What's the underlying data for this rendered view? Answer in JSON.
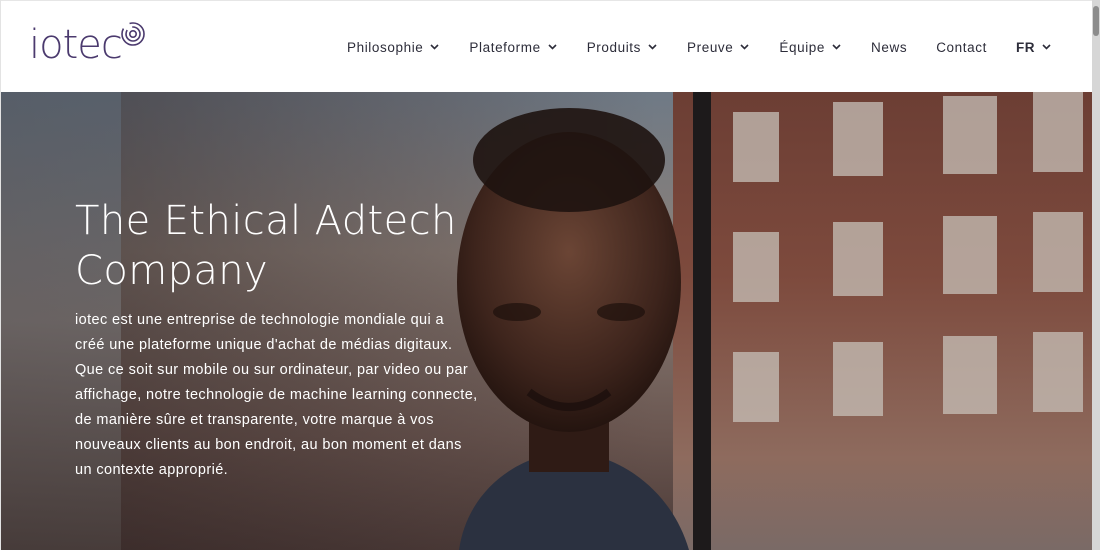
{
  "header": {
    "logo_text": "iotec",
    "nav": [
      {
        "label": "Philosophie",
        "has_dropdown": true
      },
      {
        "label": "Plateforme",
        "has_dropdown": true
      },
      {
        "label": "Produits",
        "has_dropdown": true
      },
      {
        "label": "Preuve",
        "has_dropdown": true
      },
      {
        "label": "Équipe",
        "has_dropdown": true
      },
      {
        "label": "News",
        "has_dropdown": false
      },
      {
        "label": "Contact",
        "has_dropdown": false
      },
      {
        "label": "FR",
        "has_dropdown": true
      }
    ]
  },
  "hero": {
    "title_line1": "The Ethical Adtech",
    "title_line2": "Company",
    "lines": [
      "iotec est une entreprise de technologie mondiale qui a",
      "créé une plateforme unique d'achat de médias digitaux.",
      "Que ce soit sur mobile ou sur ordinateur, par video ou par",
      "affichage, notre technologie de machine learning connecte,",
      "de manière sûre et transparente, votre marque à vos",
      "nouveaux clients au bon endroit, au bon moment et dans",
      "un contexte approprié."
    ],
    "image_description_icon": "hero-photo"
  },
  "colors": {
    "brand": "#4b3a6e",
    "nav_text": "#2d2d3a",
    "hero_text": "#ffffff"
  }
}
